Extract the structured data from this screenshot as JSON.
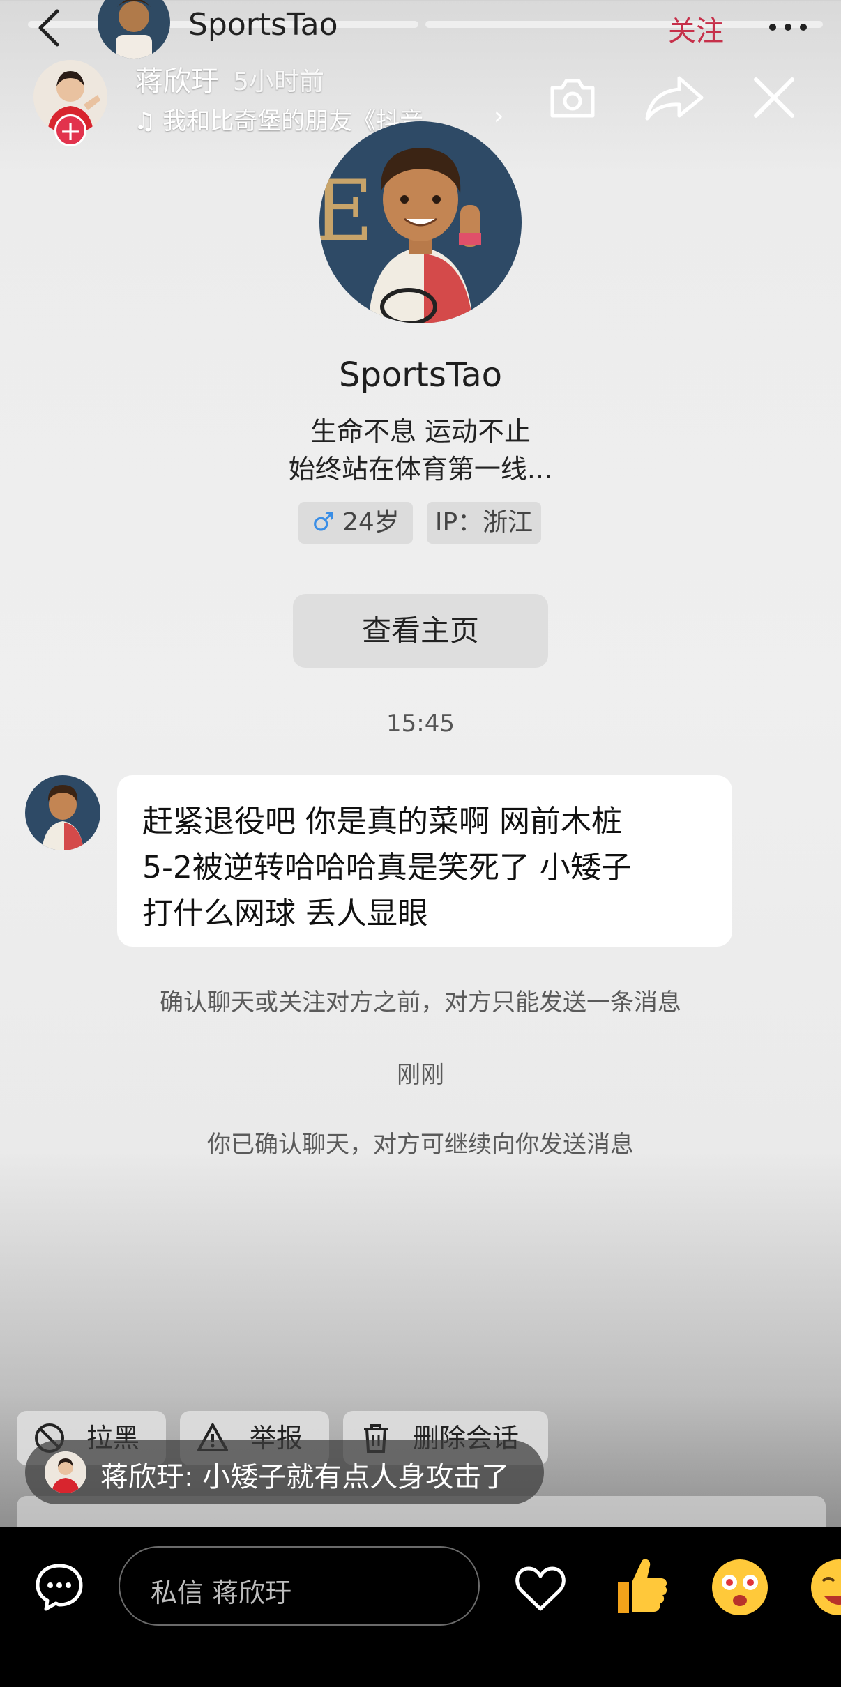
{
  "chat_header": {
    "title": "SportsTao",
    "follow_label": "关注"
  },
  "story": {
    "user_name": "蒋欣玗",
    "time_ago": "5小时前",
    "music": "♫ 我和比奇堡的朋友《抖音...",
    "chevron": "›",
    "plus": "+"
  },
  "profile": {
    "name": "SportsTao",
    "bio_line1": "生命不息 运动不止",
    "bio_line2": "始终站在体育第一线...",
    "gender_symbol": "♂",
    "age": "24岁",
    "ip": "IP：浙江",
    "homepage_button": "查看主页"
  },
  "messages": {
    "timestamp": "15:45",
    "text_line1": "赶紧退役吧 你是真的菜啊 网前木桩",
    "text_line2": "5-2被逆转哈哈哈真是笑死了 小矮子",
    "text_line3": "打什么网球 丢人显眼",
    "notice_limit": "确认聊天或关注对方之前，对方只能发送一条消息",
    "just_now": "刚刚",
    "notice_confirmed": "你已确认聊天，对方可继续向你发送消息"
  },
  "actions": {
    "block": "拉黑",
    "report": "举报",
    "delete": "删除会话"
  },
  "comment": {
    "text": "蒋欣玗: 小矮子就有点人身攻击了"
  },
  "bottom_bar": {
    "dm_placeholder": "私信 蒋欣玗"
  },
  "colors": {
    "follow_red": "#c6304a",
    "plus_badge": "#e2334d",
    "male_blue": "#3a8ee6"
  }
}
